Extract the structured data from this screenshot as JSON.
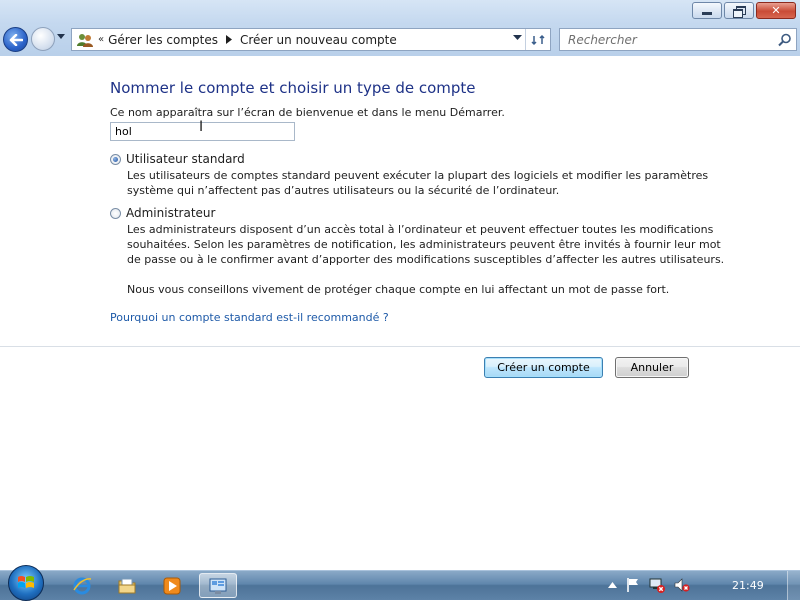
{
  "window": {
    "minimize_symbol": "—",
    "maximize_symbol": "❐",
    "close_symbol": "✕"
  },
  "navigation": {
    "overflow_symbol": "«",
    "breadcrumbs": [
      "Gérer les comptes",
      "Créer un nouveau compte"
    ],
    "search_placeholder": "Rechercher"
  },
  "form": {
    "title": "Nommer le compte et choisir un type de compte",
    "name_description": "Ce nom apparaîtra sur l’écran de bienvenue et dans le menu Démarrer.",
    "account_name": "hol",
    "options": [
      {
        "label": "Utilisateur standard",
        "selected": true,
        "description": [
          "Les utilisateurs de comptes standard peuvent exécuter la plupart des logiciels et modifier les paramètres",
          "système qui n’affectent pas d’autres utilisateurs ou la sécurité de l’ordinateur."
        ]
      },
      {
        "label": "Administrateur",
        "selected": false,
        "description": [
          "Les administrateurs disposent d’un accès total à l’ordinateur et peuvent effectuer toutes les modifications",
          "souhaitées. Selon les paramètres de notification, les administrateurs peuvent être invités à fournir leur mot",
          "de passe ou à le confirmer avant d’apporter des modifications susceptibles d’affecter les autres utilisateurs.",
          "",
          "Nous vous conseillons vivement de protéger chaque compte en lui affectant un mot de passe fort."
        ]
      }
    ],
    "help_link": "Pourquoi un compte standard est-il recommandé ?",
    "create_button": "Créer un compte",
    "cancel_button": "Annuler"
  },
  "taskbar": {
    "items": [
      "internet-explorer-icon",
      "windows-explorer-icon",
      "media-player-icon",
      "control-panel-icon"
    ],
    "clock": "21:49"
  },
  "colors": {
    "title_blue": "#1e3287",
    "link_blue": "#1e5aa8"
  }
}
